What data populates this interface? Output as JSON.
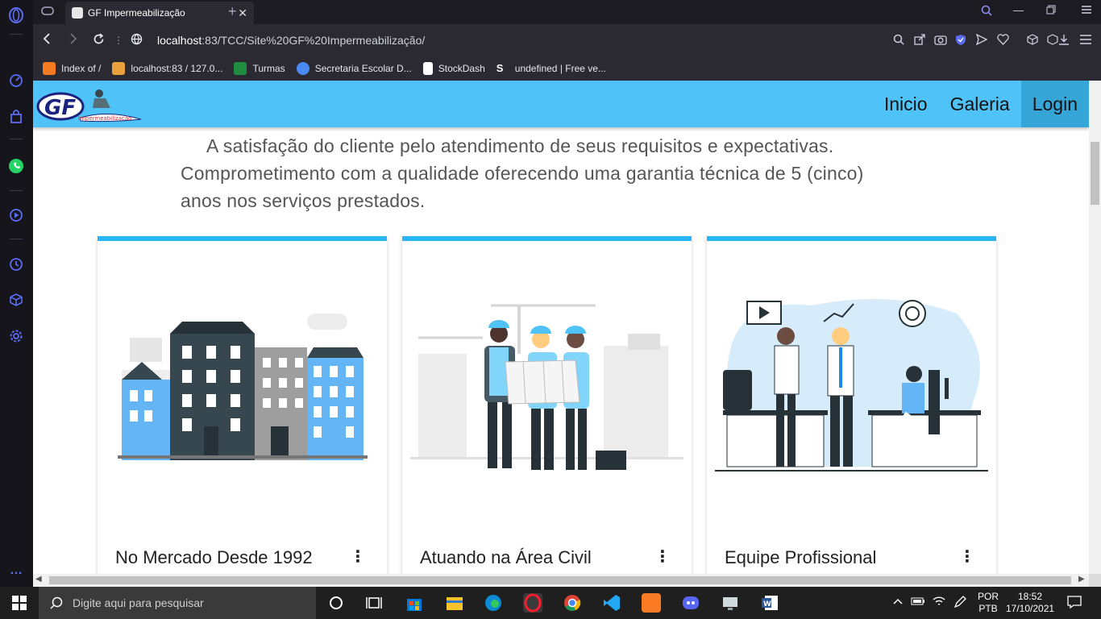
{
  "browser": {
    "tab_title": "GF Impermeabilização",
    "tab_close": "✕",
    "new_tab": "+",
    "url_host": "localhost",
    "url_rest": ":83/TCC/Site%20GF%20Impermeabilização/",
    "bookmarks": [
      {
        "label": "Index of /",
        "color": "#f47b20"
      },
      {
        "label": "localhost:83 / 127.0...",
        "color": "#e9a23b"
      },
      {
        "label": "Turmas",
        "color": "#1e8e3e"
      },
      {
        "label": "Secretaria Escolar D...",
        "color": "#4a8af4"
      },
      {
        "label": "StockDash",
        "color": "#ffffff"
      },
      {
        "label": "undefined | Free ve...",
        "color": "#2f6bff"
      }
    ]
  },
  "site": {
    "logo_text": "GF",
    "logo_sub": "Impermeabilização",
    "nav": [
      "Inicio",
      "Galeria",
      "Login"
    ],
    "intro_line1": "A satisfação do cliente pelo atendimento de seus requisitos e expectativas.",
    "intro_line2": "Comprometimento com a qualidade oferecendo uma garantia técnica de 5 (cinco) anos nos serviços prestados.",
    "cards": [
      {
        "title": "No Mercado Desde 1992",
        "more": "⋮"
      },
      {
        "title": "Atuando na Área Civil",
        "more": "⋮"
      },
      {
        "title": "Equipe Profissional",
        "more": "⋮"
      }
    ]
  },
  "taskbar": {
    "search_placeholder": "Digite aqui para pesquisar",
    "lang_top": "POR",
    "lang_bottom": "PTB",
    "time": "18:52",
    "date": "17/10/2021"
  },
  "colors": {
    "nav_bg": "#4fc3f7",
    "nav_active": "#36a6d9",
    "card_accent": "#29b6f6",
    "sidebar_icon": "#5b6cf0"
  }
}
